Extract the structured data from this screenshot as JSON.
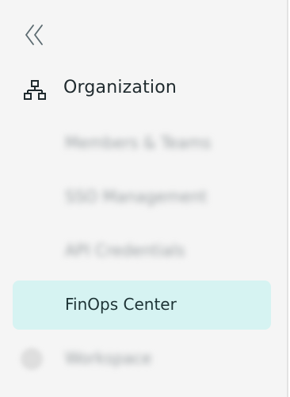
{
  "sidebar": {
    "collapse_icon": "double-chevron-left-icon",
    "section": {
      "icon": "org-chart-icon",
      "label": "Organization"
    },
    "items": [
      {
        "label": "Members & Teams",
        "obscured": true
      },
      {
        "label": "SSO Management",
        "obscured": true
      },
      {
        "label": "API Credentials",
        "obscured": true
      },
      {
        "label": "FinOps Center",
        "active": true
      }
    ],
    "next_section": {
      "icon": "workspace-icon",
      "label": "Workspace",
      "obscured": true
    }
  },
  "colors": {
    "sidebar_bg": "#f5f5f5",
    "active_bg": "#d6f3f2",
    "text": "#1f2a2e",
    "muted": "#9aa0a3"
  }
}
